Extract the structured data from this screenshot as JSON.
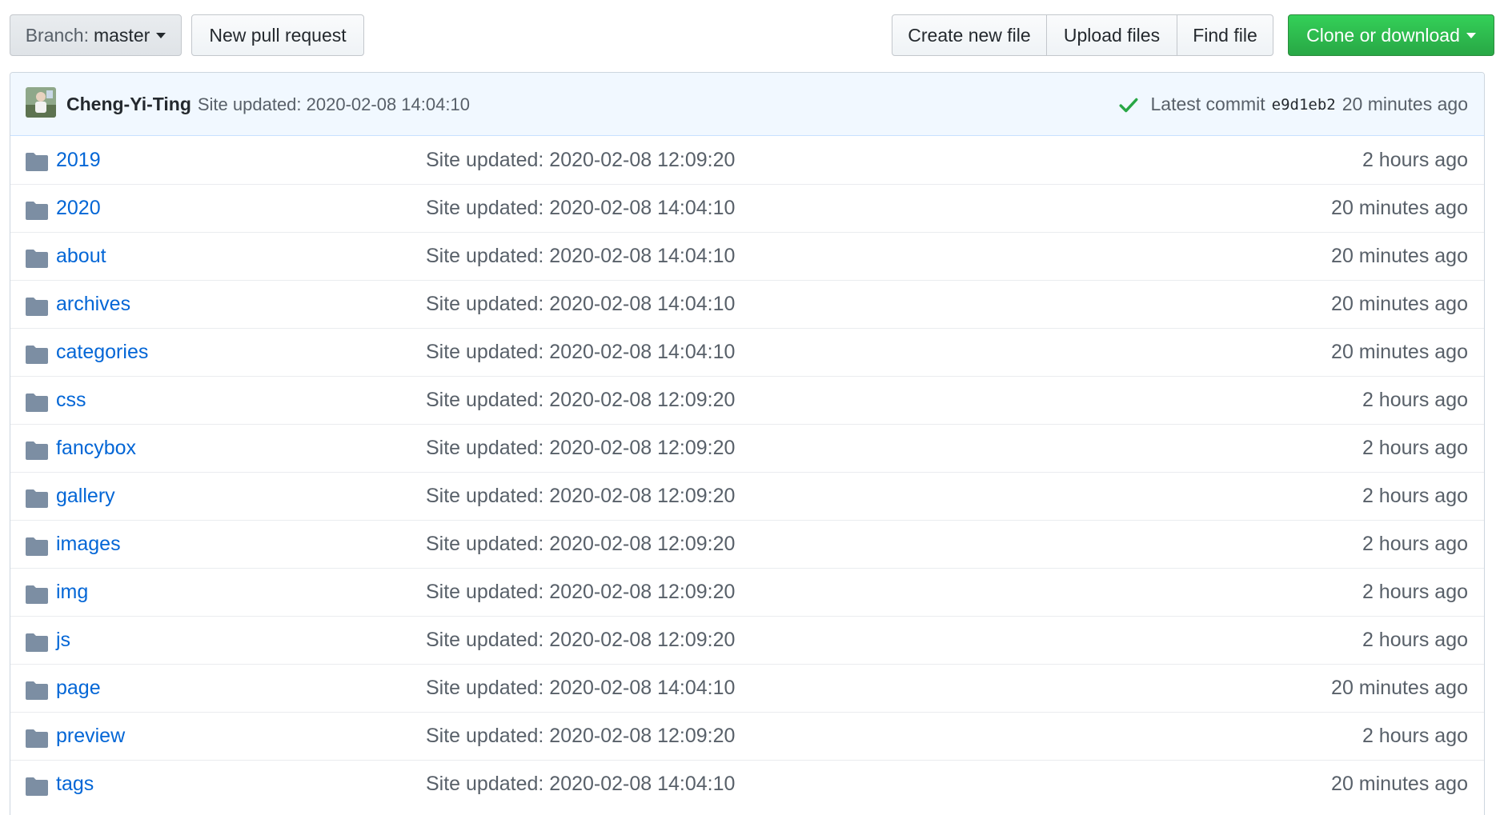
{
  "toolbar": {
    "branch_prefix": "Branch:",
    "branch_name": "master",
    "new_pr_label": "New pull request",
    "create_file_label": "Create new file",
    "upload_label": "Upload files",
    "find_label": "Find file",
    "clone_label": "Clone or download"
  },
  "commit": {
    "author": "Cheng-Yi-Ting",
    "message": "Site updated: 2020-02-08 14:04:10",
    "latest_label": "Latest commit",
    "sha": "e9d1eb2",
    "age": "20 minutes ago",
    "status_color": "#28a745",
    "status_icon": "check-icon"
  },
  "files": [
    {
      "name": "2019",
      "message": "Site updated: 2020-02-08 12:09:20",
      "age": "2 hours ago"
    },
    {
      "name": "2020",
      "message": "Site updated: 2020-02-08 14:04:10",
      "age": "20 minutes ago"
    },
    {
      "name": "about",
      "message": "Site updated: 2020-02-08 14:04:10",
      "age": "20 minutes ago"
    },
    {
      "name": "archives",
      "message": "Site updated: 2020-02-08 14:04:10",
      "age": "20 minutes ago"
    },
    {
      "name": "categories",
      "message": "Site updated: 2020-02-08 14:04:10",
      "age": "20 minutes ago"
    },
    {
      "name": "css",
      "message": "Site updated: 2020-02-08 12:09:20",
      "age": "2 hours ago"
    },
    {
      "name": "fancybox",
      "message": "Site updated: 2020-02-08 12:09:20",
      "age": "2 hours ago"
    },
    {
      "name": "gallery",
      "message": "Site updated: 2020-02-08 12:09:20",
      "age": "2 hours ago"
    },
    {
      "name": "images",
      "message": "Site updated: 2020-02-08 12:09:20",
      "age": "2 hours ago"
    },
    {
      "name": "img",
      "message": "Site updated: 2020-02-08 12:09:20",
      "age": "2 hours ago"
    },
    {
      "name": "js",
      "message": "Site updated: 2020-02-08 12:09:20",
      "age": "2 hours ago"
    },
    {
      "name": "page",
      "message": "Site updated: 2020-02-08 14:04:10",
      "age": "20 minutes ago"
    },
    {
      "name": "preview",
      "message": "Site updated: 2020-02-08 12:09:20",
      "age": "2 hours ago"
    },
    {
      "name": "tags",
      "message": "Site updated: 2020-02-08 14:04:10",
      "age": "20 minutes ago"
    }
  ],
  "colors": {
    "link": "#0366d6",
    "muted": "#586069",
    "clone_green": "#28a745",
    "folder": "#79b8ff",
    "commit_bar_bg": "#f1f8ff"
  }
}
